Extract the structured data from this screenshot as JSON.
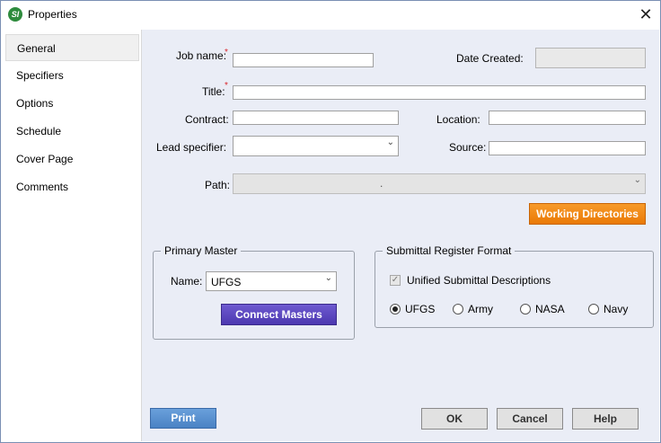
{
  "window": {
    "title": "Properties",
    "app_icon_text": "SI",
    "close_glyph": "✕"
  },
  "sidebar": {
    "items": [
      {
        "label": "General"
      },
      {
        "label": "Specifiers"
      },
      {
        "label": "Options"
      },
      {
        "label": "Schedule"
      },
      {
        "label": "Cover Page"
      },
      {
        "label": "Comments"
      }
    ],
    "active": "General"
  },
  "form": {
    "job_name_label": "Job name:",
    "required_mark": "*",
    "date_created_label": "Date Created:",
    "title_label": "Title:",
    "contract_label": "Contract:",
    "location_label": "Location:",
    "lead_specifier_label": "Lead specifier:",
    "source_label": "Source:",
    "path_label": "Path:",
    "path_value": ".",
    "job_name_value": "",
    "date_created_value": "",
    "title_value": "",
    "contract_value": "",
    "location_value": "",
    "lead_specifier_value": "",
    "source_value": "",
    "working_directories_label": "Working Directories"
  },
  "primary_master": {
    "legend": "Primary Master",
    "name_label": "Name:",
    "name_value": "UFGS",
    "connect_label": "Connect Masters"
  },
  "submittal": {
    "legend": "Submittal Register Format",
    "checkbox_label": "Unified Submittal Descriptions",
    "checkbox_checked": true,
    "options": [
      {
        "label": "UFGS",
        "checked": true
      },
      {
        "label": "Army",
        "checked": false
      },
      {
        "label": "NASA",
        "checked": false
      },
      {
        "label": "Navy",
        "checked": false
      }
    ]
  },
  "footer": {
    "print_label": "Print",
    "ok_label": "OK",
    "cancel_label": "Cancel",
    "help_label": "Help"
  },
  "icons": {
    "chevron": "⌄",
    "check": "✓"
  }
}
